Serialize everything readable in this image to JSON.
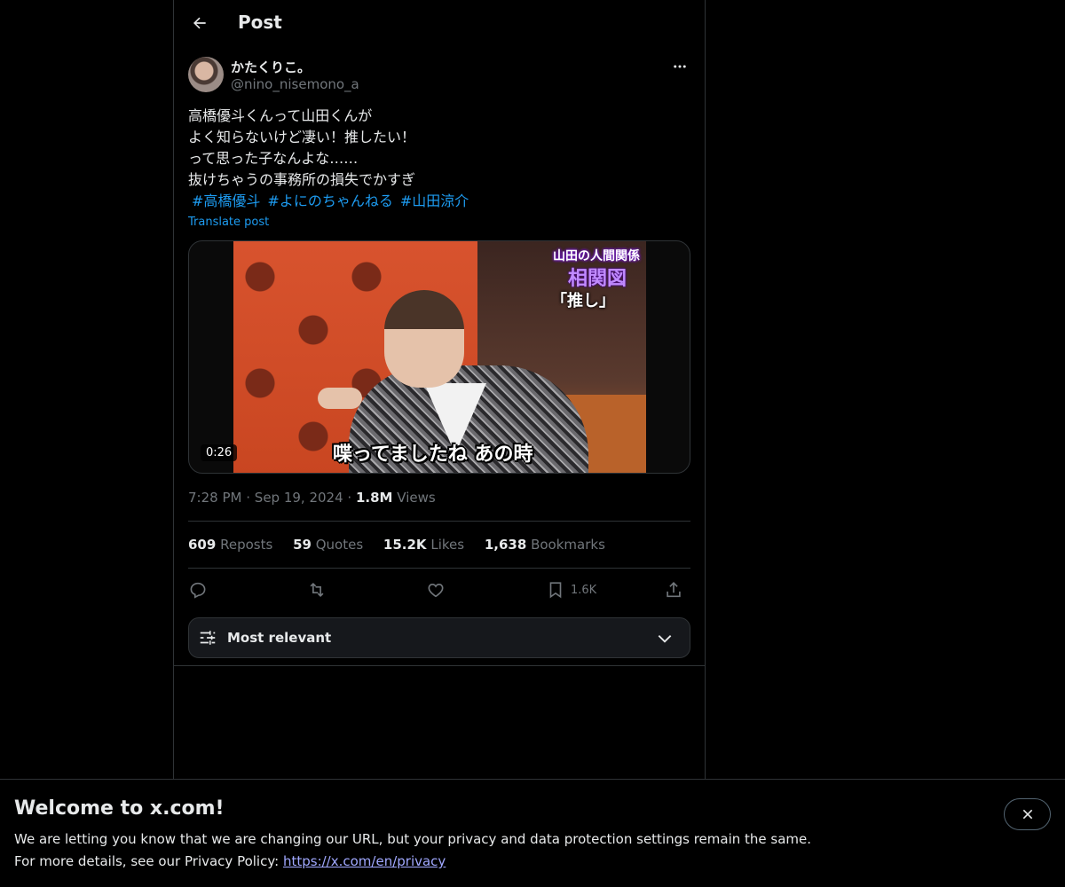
{
  "header": {
    "title": "Post"
  },
  "author": {
    "name": "かたくりこ。",
    "handle": "@nino_nisemono_a"
  },
  "post": {
    "lines": [
      "高橋優斗くんって山田くんが",
      "よく知らないけど凄い！推したい！",
      "って思った子なんよな……",
      "抜けちゃうの事務所の損失でかすぎ"
    ],
    "hashtags": [
      "#高橋優斗",
      "#よにのちゃんねる",
      "#山田涼介"
    ],
    "translate_label": "Translate post"
  },
  "media": {
    "overlay_small": "山田の人間関係",
    "overlay_big": "相関図",
    "overlay_quote": "「推し」",
    "subtitle": "喋ってましたね あの時",
    "duration": "0:26"
  },
  "meta": {
    "time": "7:28 PM",
    "sep": "·",
    "date": "Sep 19, 2024",
    "views_count": "1.8M",
    "views_label": "Views"
  },
  "stats": {
    "reposts": {
      "num": "609",
      "label": "Reposts"
    },
    "quotes": {
      "num": "59",
      "label": "Quotes"
    },
    "likes": {
      "num": "15.2K",
      "label": "Likes"
    },
    "bookmarks": {
      "num": "1,638",
      "label": "Bookmarks"
    }
  },
  "actions": {
    "bookmark_count": "1.6K"
  },
  "sort": {
    "label": "Most relevant"
  },
  "banner": {
    "title": "Welcome to x.com!",
    "text1": "We are letting you know that we are changing our URL, but your privacy and data protection settings remain the same.",
    "text2_prefix": "For more details, see our Privacy Policy:",
    "link": "https://x.com/en/privacy"
  },
  "colors": {
    "accent": "#1d9bf0",
    "muted": "#71767b",
    "border": "#2f3336",
    "link": "#a0a8ff"
  }
}
